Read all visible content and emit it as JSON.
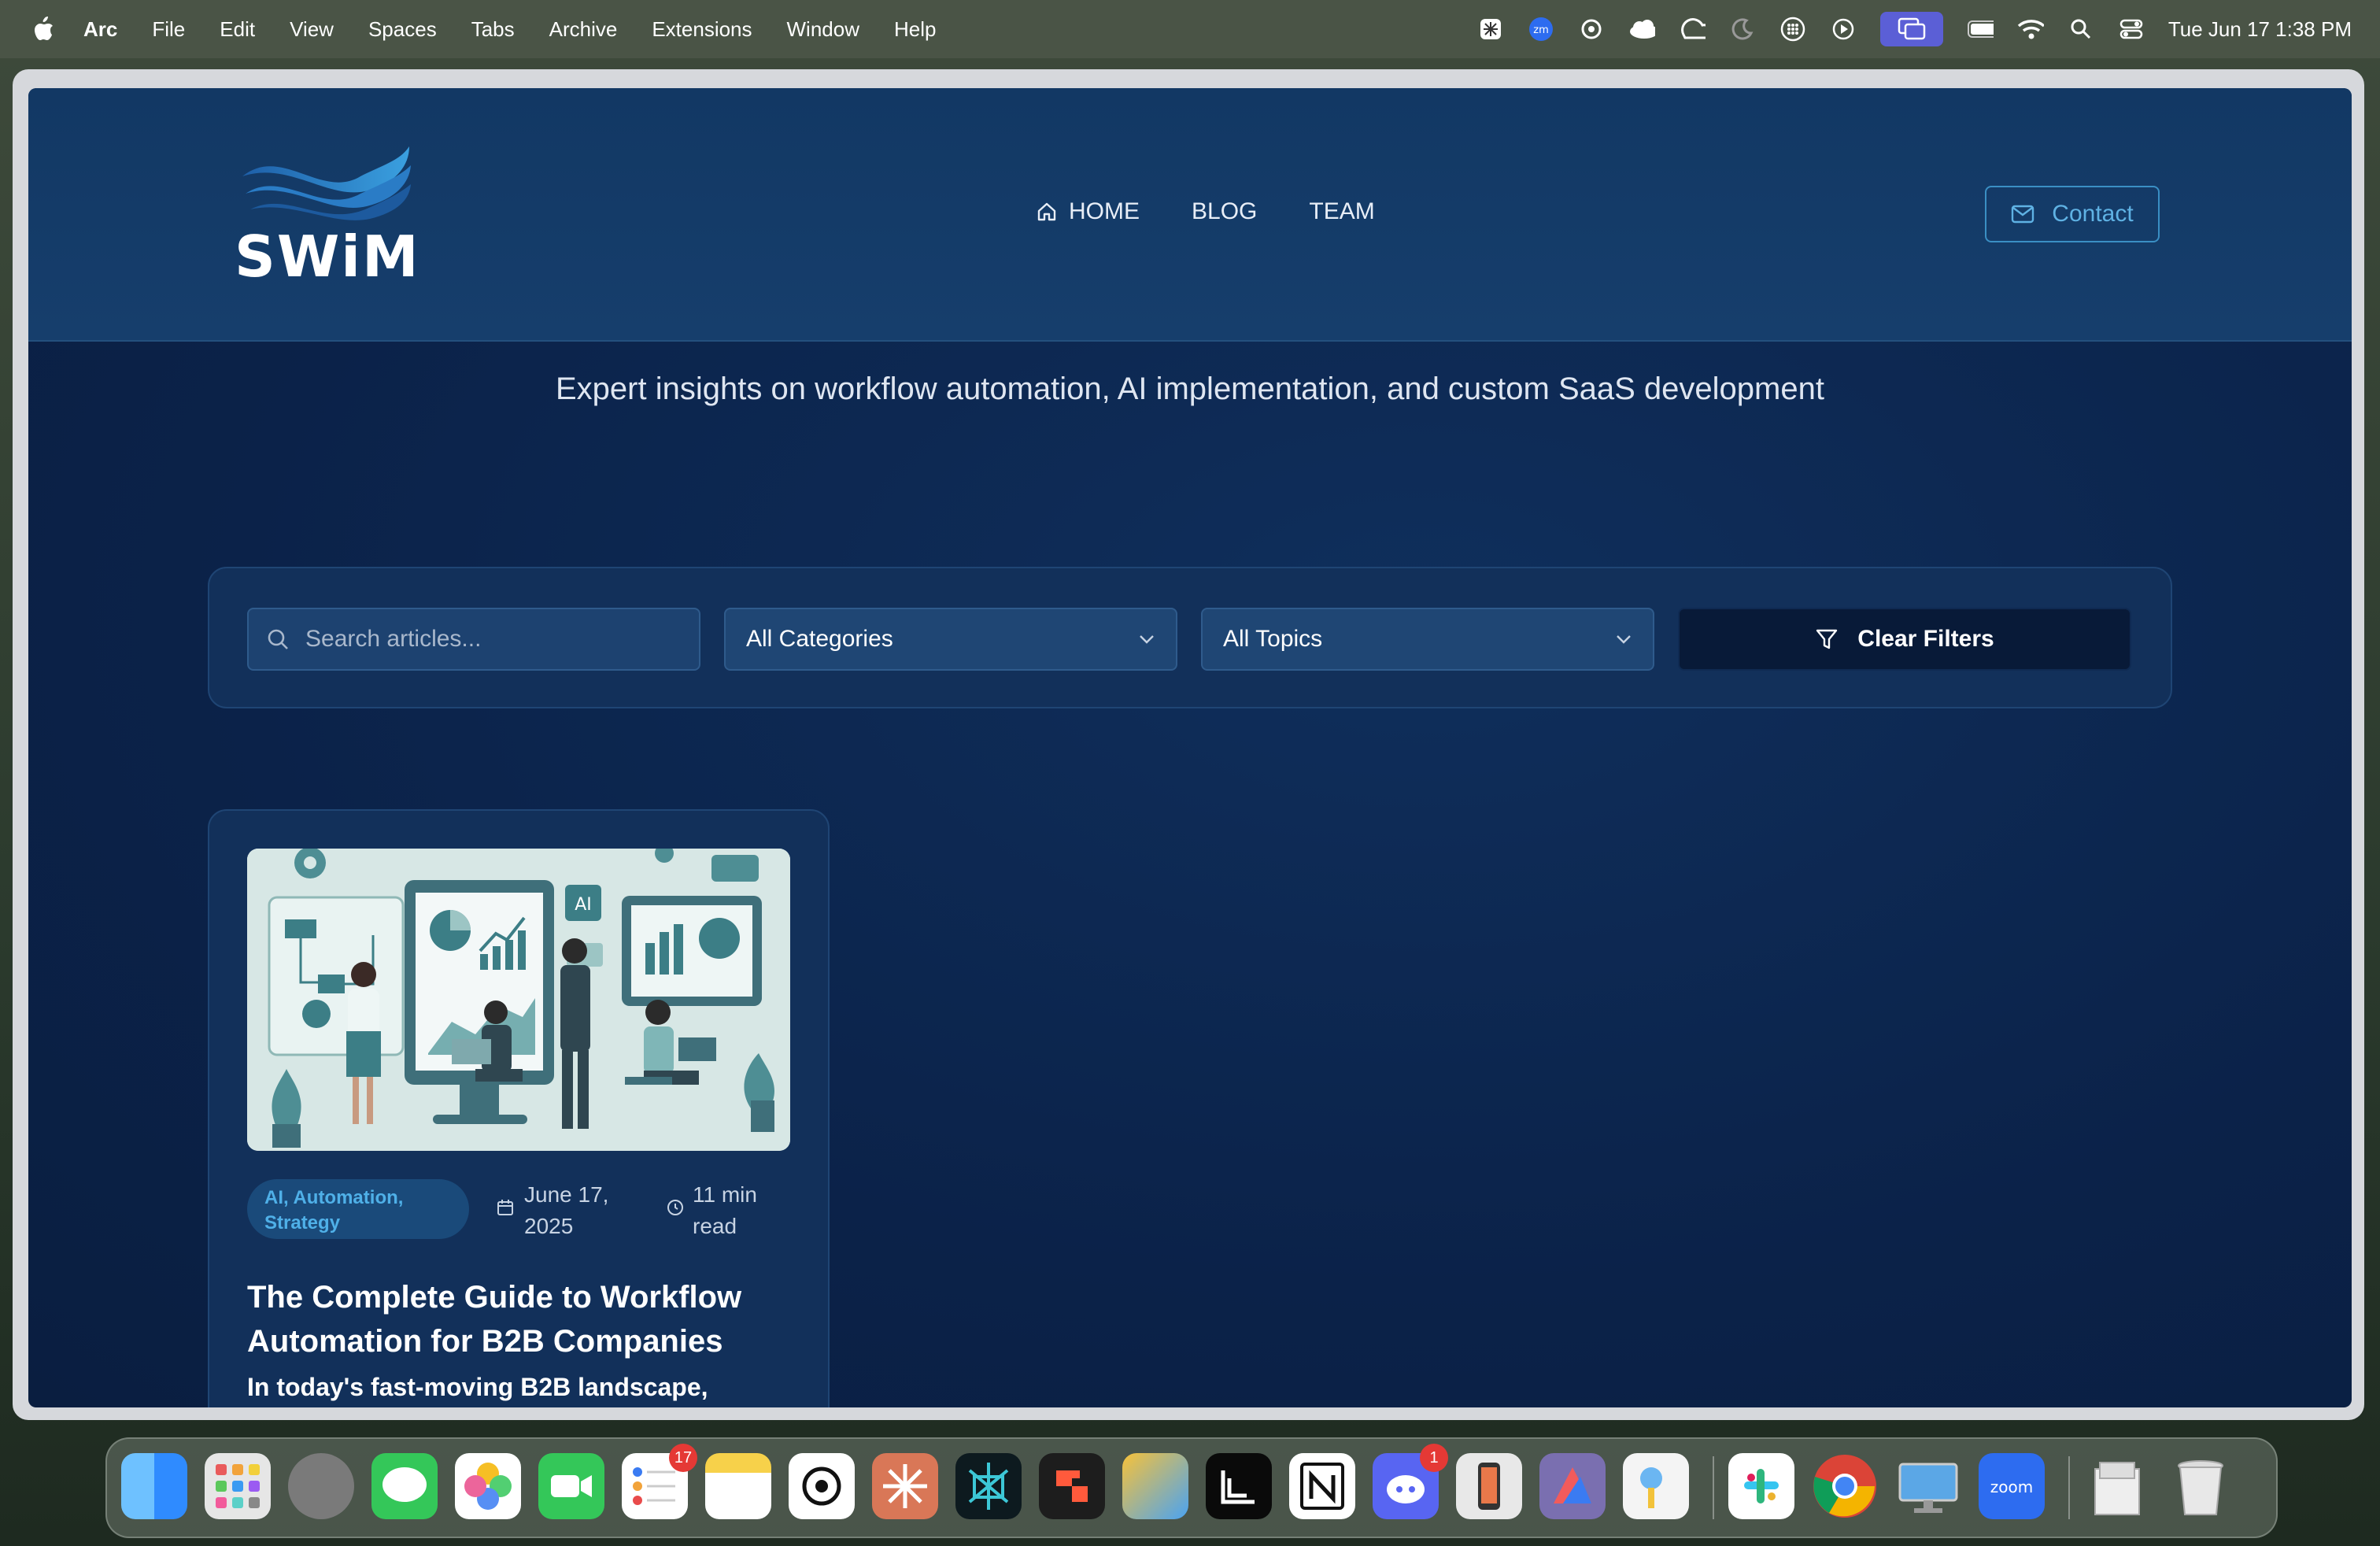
{
  "menubar": {
    "app_name": "Arc",
    "items": [
      "File",
      "Edit",
      "View",
      "Spaces",
      "Tabs",
      "Archive",
      "Extensions",
      "Window",
      "Help"
    ],
    "clock": "Tue Jun 17  1:38 PM",
    "tray_icons": [
      "perplexity-icon",
      "zoom-icon",
      "chatgpt-icon",
      "cloud-icon",
      "creative-cloud-icon",
      "focus-icon",
      "grid-icon",
      "play-icon",
      "screen-mirror-icon",
      "battery-icon",
      "wifi-icon",
      "search-icon",
      "control-center-icon"
    ]
  },
  "site": {
    "logo_text": "SWiM",
    "nav": [
      {
        "label": "HOME",
        "icon": "home-icon"
      },
      {
        "label": "BLOG"
      },
      {
        "label": "TEAM"
      }
    ],
    "contact_label": "Contact",
    "tagline": "Expert insights on workflow automation, AI implementation, and custom SaaS development"
  },
  "filters": {
    "search_placeholder": "Search articles...",
    "category": "All Categories",
    "topic": "All Topics",
    "clear_label": "Clear Filters"
  },
  "card": {
    "tags": "AI, Automation, Strategy",
    "date": "June 17, 2025",
    "read_time": "11 min read",
    "title": "The Complete Guide to Workflow Automation for B2B Companies",
    "excerpt": "In today's fast-moving B2B landscape,",
    "image_ai_label": "AI"
  },
  "dock": {
    "apps": [
      "finder",
      "launchpad",
      "system-settings",
      "messages",
      "photos",
      "facetime",
      "reminders",
      "notes",
      "chatgpt",
      "claude",
      "perplexity",
      "raycast",
      "airmail",
      "linear",
      "notion",
      "discord",
      "simulator",
      "affinity",
      "keychain",
      "slack",
      "chrome",
      "screens",
      "zoom",
      "downloads",
      "trash"
    ],
    "reminders_badge": "17",
    "discord_badge": "1",
    "zoom_label": "zoom"
  },
  "colors": {
    "page_bg": "#0b2249",
    "accent": "#3a8fc4",
    "header_bg": "#123864"
  }
}
